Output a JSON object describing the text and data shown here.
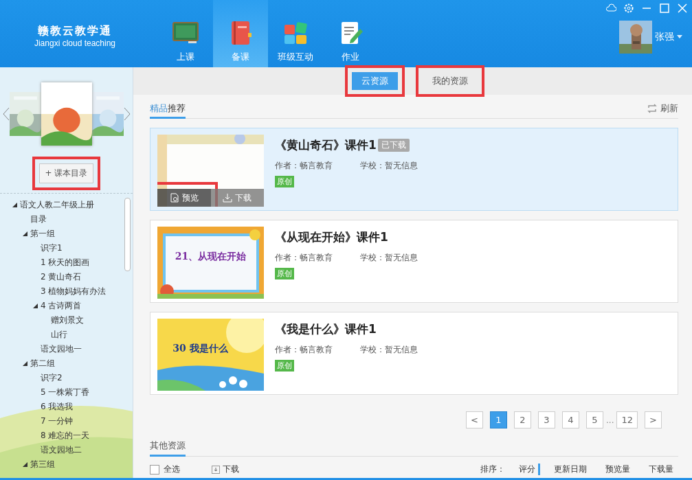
{
  "app": {
    "name": "赣教云教学通",
    "subtitle": "Jiangxi cloud teaching"
  },
  "nav": [
    {
      "label": "上课",
      "kind": "board",
      "selected": false
    },
    {
      "label": "备课",
      "kind": "book",
      "selected": true
    },
    {
      "label": "班级互动",
      "kind": "blocks",
      "selected": false
    },
    {
      "label": "作业",
      "kind": "note",
      "selected": false
    }
  ],
  "user": {
    "name": "张强"
  },
  "sidebar": {
    "catalog_button": {
      "label": "+ 课本目录",
      "highlighted": true
    },
    "tree": [
      {
        "label": "语文人教二年级上册",
        "expanded": true,
        "children": [
          {
            "label": "目录"
          },
          {
            "label": "第一组",
            "expanded": true,
            "children": [
              {
                "label": "识字1"
              },
              {
                "label": "1 秋天的图画"
              },
              {
                "label": "2 黄山奇石"
              },
              {
                "label": "3 植物妈妈有办法"
              },
              {
                "label": "4 古诗两首",
                "expanded": true,
                "children": [
                  {
                    "label": "赠刘景文"
                  },
                  {
                    "label": "山行"
                  }
                ]
              },
              {
                "label": "语文园地一"
              }
            ]
          },
          {
            "label": "第二组",
            "expanded": true,
            "children": [
              {
                "label": "识字2"
              },
              {
                "label": "5 一株紫丁香"
              },
              {
                "label": "6 我选我"
              },
              {
                "label": "7 一分钟"
              },
              {
                "label": "8 难忘的一天"
              },
              {
                "label": "语文园地二"
              }
            ]
          },
          {
            "label": "第三组",
            "expanded": true
          }
        ]
      }
    ]
  },
  "source_tabs": [
    {
      "label": "云资源",
      "selected": true,
      "highlighted": true
    },
    {
      "label": "我的资源",
      "selected": false,
      "highlighted": true
    }
  ],
  "featured": {
    "title_accent": "精品",
    "title_rest": "推荐",
    "refresh": "刷新",
    "items": [
      {
        "title": "《黄山奇石》课件1",
        "badge": "已下载",
        "author": "作者：畅言教育",
        "school": "学校：暂无信息",
        "tag": "原创",
        "selected": true,
        "kind": "frame",
        "actions": [
          {
            "label": "预览",
            "kind": "preview",
            "highlighted": true
          },
          {
            "label": "下载",
            "kind": "download",
            "highlighted": false
          }
        ]
      },
      {
        "title": "《从现在开始》课件1",
        "author": "作者：畅言教育",
        "school": "学校：暂无信息",
        "tag": "原创",
        "selected": false,
        "kind": "sky",
        "thumb_text": "21、从现在开始"
      },
      {
        "title": "《我是什么》课件1",
        "author": "作者：畅言教育",
        "school": "学校：暂无信息",
        "tag": "原创",
        "selected": false,
        "kind": "sun",
        "thumb_text": "30  我是什么"
      }
    ]
  },
  "pagination": [
    {
      "label": "<",
      "kind": "prev"
    },
    {
      "label": "1",
      "kind": "page",
      "selected": true
    },
    {
      "label": "2",
      "kind": "page",
      "selected": false
    },
    {
      "label": "3",
      "kind": "page",
      "selected": false
    },
    {
      "label": "4",
      "kind": "page",
      "selected": false
    },
    {
      "label": "5",
      "kind": "page",
      "selected": false
    },
    {
      "label": "...",
      "kind": "gap"
    },
    {
      "label": "12",
      "kind": "page",
      "selected": false
    },
    {
      "label": ">",
      "kind": "next"
    }
  ],
  "other": {
    "title": "其他资源",
    "select_all": "全选",
    "select_all_checked": false,
    "download": "下载",
    "sort_label": "排序：",
    "sort_options": [
      {
        "label": "评分",
        "selected": true
      },
      {
        "label": "更新日期",
        "selected": false
      },
      {
        "label": "预览量",
        "selected": false
      },
      {
        "label": "下载量",
        "selected": false
      }
    ]
  }
}
